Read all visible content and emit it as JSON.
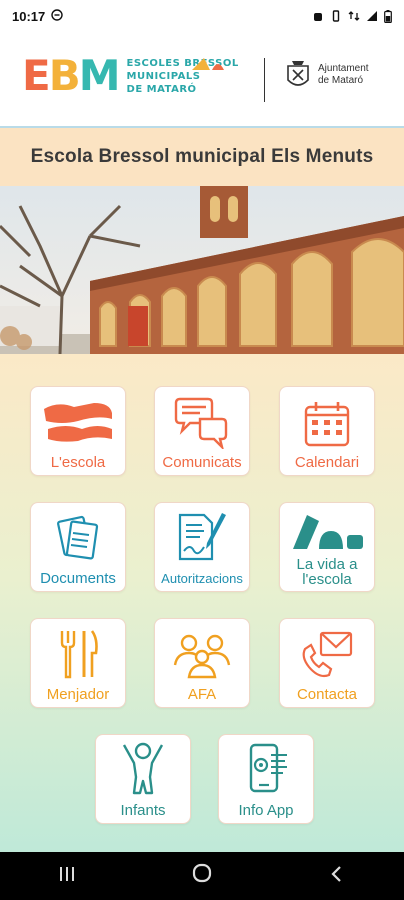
{
  "status_bar": {
    "time": "10:17"
  },
  "header": {
    "logo_letters": [
      "E",
      "B",
      "M"
    ],
    "logo_sub": [
      "ESCOLES BRESSOL",
      "MUNICIPALS",
      "DE MATARÓ"
    ],
    "ajuntament": [
      "Ajuntament",
      "de Mataró"
    ]
  },
  "school_title": "Escola Bressol municipal Els Menuts",
  "menu": {
    "tiles": [
      {
        "label": "L'escola",
        "icon": "school-building-icon",
        "color": "#ef6a45"
      },
      {
        "label": "Comunicats",
        "icon": "chat-bubbles-icon",
        "color": "#ef6a45"
      },
      {
        "label": "Calendari",
        "icon": "calendar-icon",
        "color": "#ef6a45"
      },
      {
        "label": "Documents",
        "icon": "documents-icon",
        "color": "#1f8fb0"
      },
      {
        "label": "Autoritzacions",
        "icon": "signature-icon",
        "color": "#1f8fb0"
      },
      {
        "label": "La vida a l'escola",
        "icon": "school-life-icon",
        "color": "#2a8f8a"
      },
      {
        "label": "Menjador",
        "icon": "cutlery-icon",
        "color": "#f0a020"
      },
      {
        "label": "AFA",
        "icon": "people-icon",
        "color": "#f0a020"
      },
      {
        "label": "Contacta",
        "icon": "phone-mail-icon",
        "color": "#f0a020"
      },
      {
        "label": "Infants",
        "icon": "child-icon",
        "color": "#2a8f8a"
      },
      {
        "label": "Info App",
        "icon": "phone-settings-icon",
        "color": "#2a8f8a"
      }
    ]
  },
  "colors": {
    "orange": "#ef6a45",
    "teal": "#1f8fb0",
    "yellow": "#f0a020",
    "green": "#2a8f8a",
    "banner": "#fbe3c2"
  }
}
